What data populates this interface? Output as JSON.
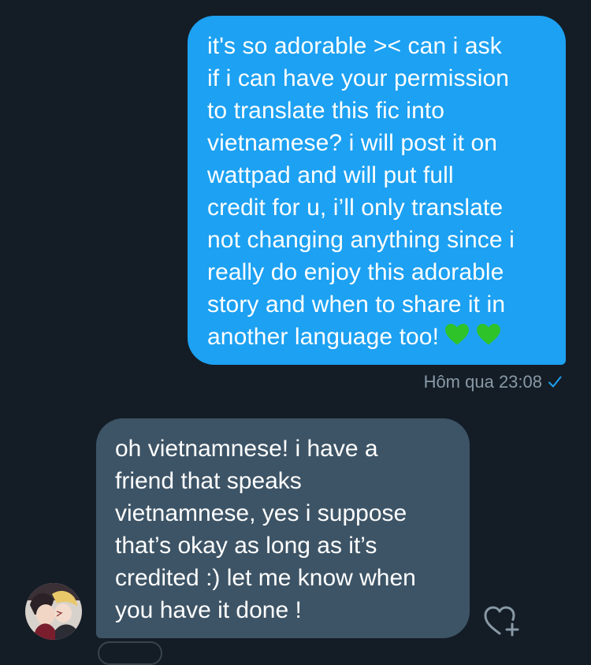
{
  "thread": {
    "outgoing": {
      "lines": [
        "it's so adorable >< can i ask",
        "if i can have your permission",
        "to translate this fic into",
        "vietnamese? i will post it on",
        "wattpad and will put full",
        "credit for u, i’ll only translate",
        "not changing anything since i",
        "really do enjoy this adorable",
        "story and when to share it in",
        "another language too!"
      ],
      "emoji": "green-heart-icon ×2",
      "timestamp": "Hôm qua 23:08",
      "status_icon": "check-icon",
      "bubble_color": "#1da1f2"
    },
    "incoming": {
      "lines": [
        "oh vietnamnese! i have a",
        "friend that speaks",
        "vietnamnese, yes i suppose",
        "that’s okay as long as it’s",
        "credited :) let me know when",
        "you have it done !"
      ],
      "bubble_color": "#3d5466",
      "avatar_icon": "avatar",
      "like_icon": "heart-plus-icon"
    }
  },
  "colors": {
    "background": "#141d26",
    "meta_text": "#8899a6",
    "accent": "#1da1f2",
    "emoji_heart": "#2fc32a"
  }
}
